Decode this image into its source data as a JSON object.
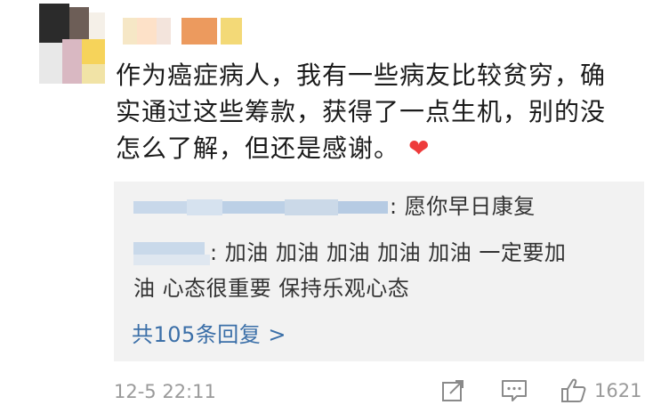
{
  "comment": {
    "text_line1": "作为癌症病人，我有一些病友比较贫穷，确",
    "text_line2": "实通过这些筹款，获得了一点生机，别的没",
    "text_line3": "怎么了解，但还是感谢。",
    "emoji_icon": "red-heart-icon"
  },
  "replies": {
    "reply1_suffix": ": 愿你早日康复",
    "reply2_line1_suffix": ": 加油 加油 加油 加油  加油 一定要加",
    "reply2_line2": "油 心态很重要    保持乐观心态",
    "more_label": "共105条回复 >"
  },
  "footer": {
    "timestamp": "12-5 22:11",
    "like_count": "1621"
  },
  "colors": {
    "link": "#3b6fa8",
    "heart": "#ee3b3b",
    "reply_bg": "#f2f2f2",
    "meta_gray": "#9a9a9a"
  }
}
